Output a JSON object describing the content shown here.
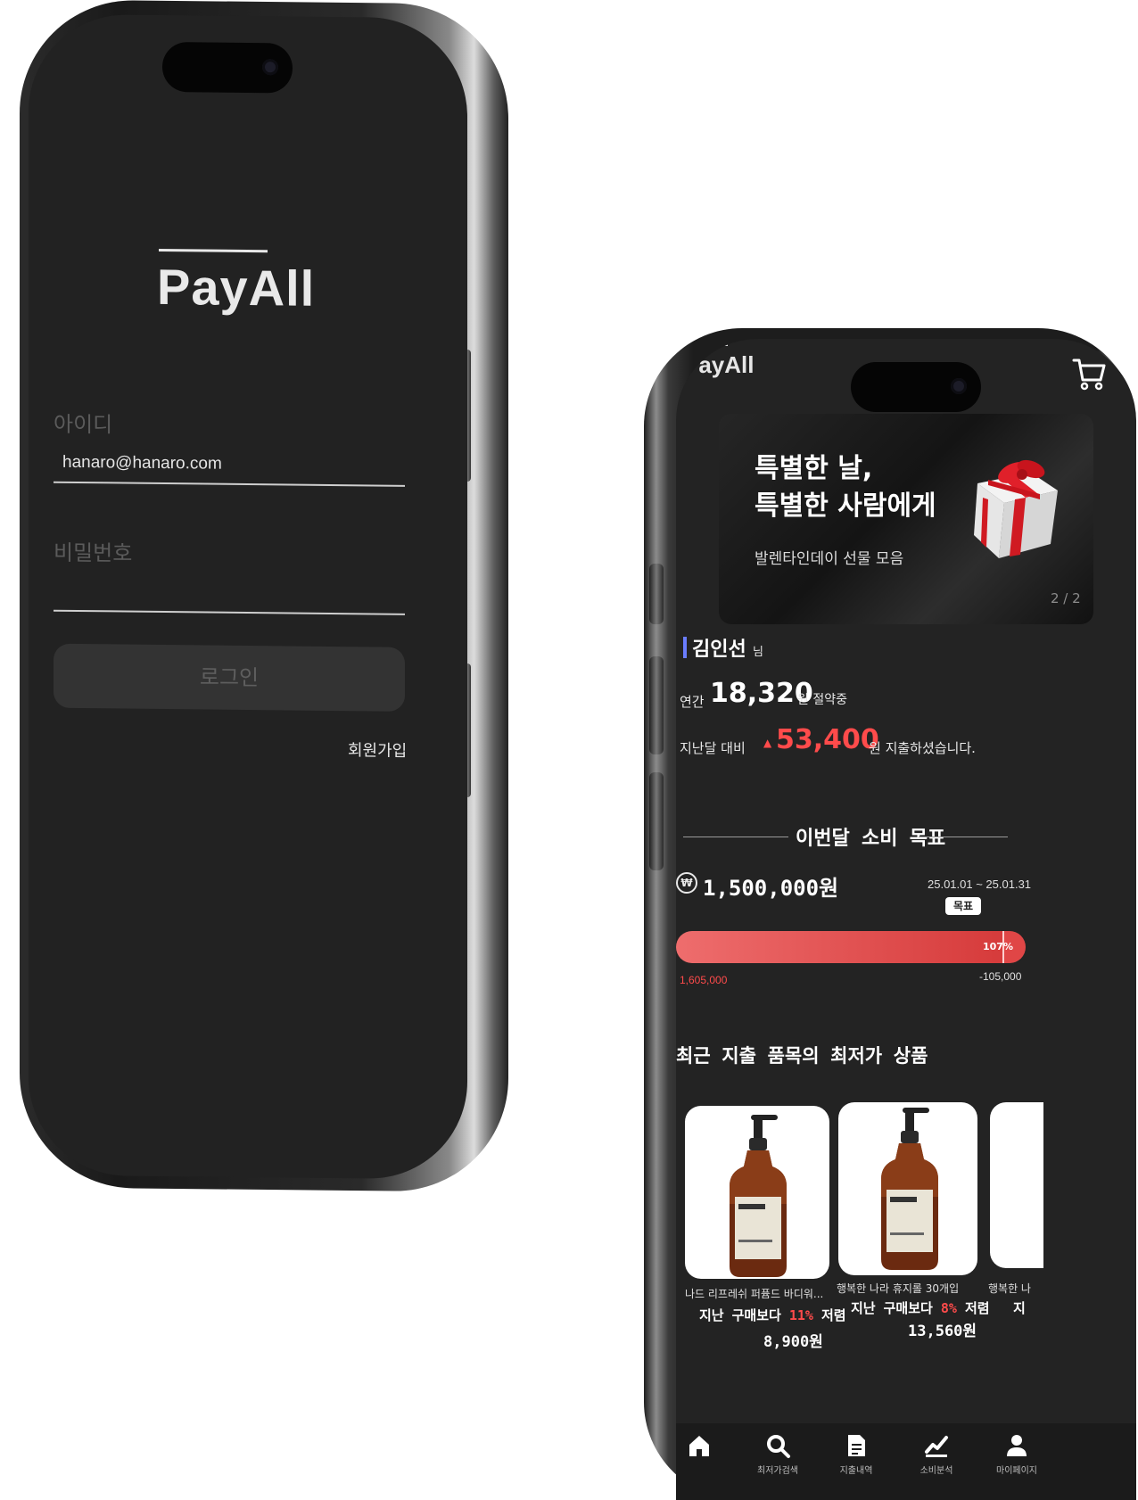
{
  "login_screen": {
    "logo": "PayAll",
    "id_label": "아이디",
    "id_value": "hanaro@hanaro.com",
    "password_label": "비밀번호",
    "password_value": "",
    "login_button": "로그인",
    "signup_link": "회원가입"
  },
  "home_screen": {
    "logo": "PayAll",
    "cart_icon": "cart-icon",
    "banner": {
      "title_line1": "특별한 날,",
      "title_line2": "특별한 사람에게",
      "subtitle": "발렌타인데이 선물 모음",
      "page": "2 / 2"
    },
    "user": {
      "name": "김인선",
      "suffix": "님",
      "annual_prefix": "연간",
      "annual_saving": "18,320",
      "annual_suffix": "원 절약중",
      "compare_prefix": "지난달 대비",
      "compare_arrow": "▲",
      "compare_amount": "53,400",
      "compare_suffix": "원 지출하셨습니다."
    },
    "goal": {
      "section_title": "이번달 소비 목표",
      "amount": "1,500,000원",
      "period": "25.01.01 ~ 25.01.31",
      "target_badge": "목표",
      "percent_label": "107%",
      "progress_percent": 107,
      "used_amount": "1,605,000",
      "remaining_amount": "-105,000"
    },
    "products_title": "최근 지출 품목의 최저가 상품",
    "products": [
      {
        "name": "나드 리프레쉬 퍼퓸드 바디워...",
        "discount_prefix": "지난 구매보다",
        "discount_pct": "11%",
        "discount_suffix": "저렴",
        "price": "8,900원"
      },
      {
        "name": "행복한 나라 휴지롤 30개입",
        "discount_prefix": "지난 구매보다",
        "discount_pct": "8%",
        "discount_suffix": "저렴",
        "price": "13,560원"
      },
      {
        "name": "행복한 나",
        "discount_prefix": "지",
        "discount_pct": "",
        "discount_suffix": "",
        "price": ""
      }
    ],
    "tabs": [
      {
        "label": "",
        "icon": "home-icon"
      },
      {
        "label": "최저가검색",
        "icon": "search-icon"
      },
      {
        "label": "지출내역",
        "icon": "receipt-icon"
      },
      {
        "label": "소비분석",
        "icon": "chart-icon"
      },
      {
        "label": "마이페이지",
        "icon": "user-icon"
      }
    ],
    "colors": {
      "accent_red": "#ff4b4b",
      "name_bar": "#6a7dff",
      "background": "#232323"
    }
  }
}
